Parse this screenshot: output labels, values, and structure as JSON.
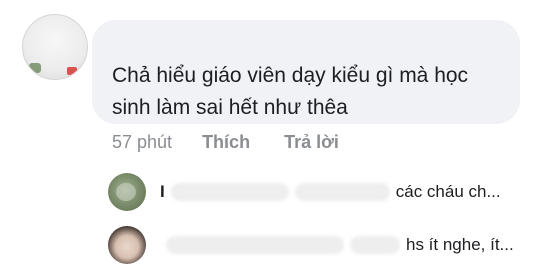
{
  "comment": {
    "text": "Chả hiểu giáo viên dạy kiểu gì mà học sinh làm sai hết như thêa"
  },
  "actions": {
    "time": "57 phút",
    "like_label": "Thích",
    "reply_label": "Trả lời"
  },
  "replies": [
    {
      "name_visible": "I",
      "snippet": "các cháu ch..."
    },
    {
      "name_visible": "",
      "snippet": "hs ít nghe, ít..."
    }
  ],
  "colors": {
    "bubble": "#f0f2f5",
    "muted_text": "#8a8d91",
    "text": "#1c1e21"
  }
}
